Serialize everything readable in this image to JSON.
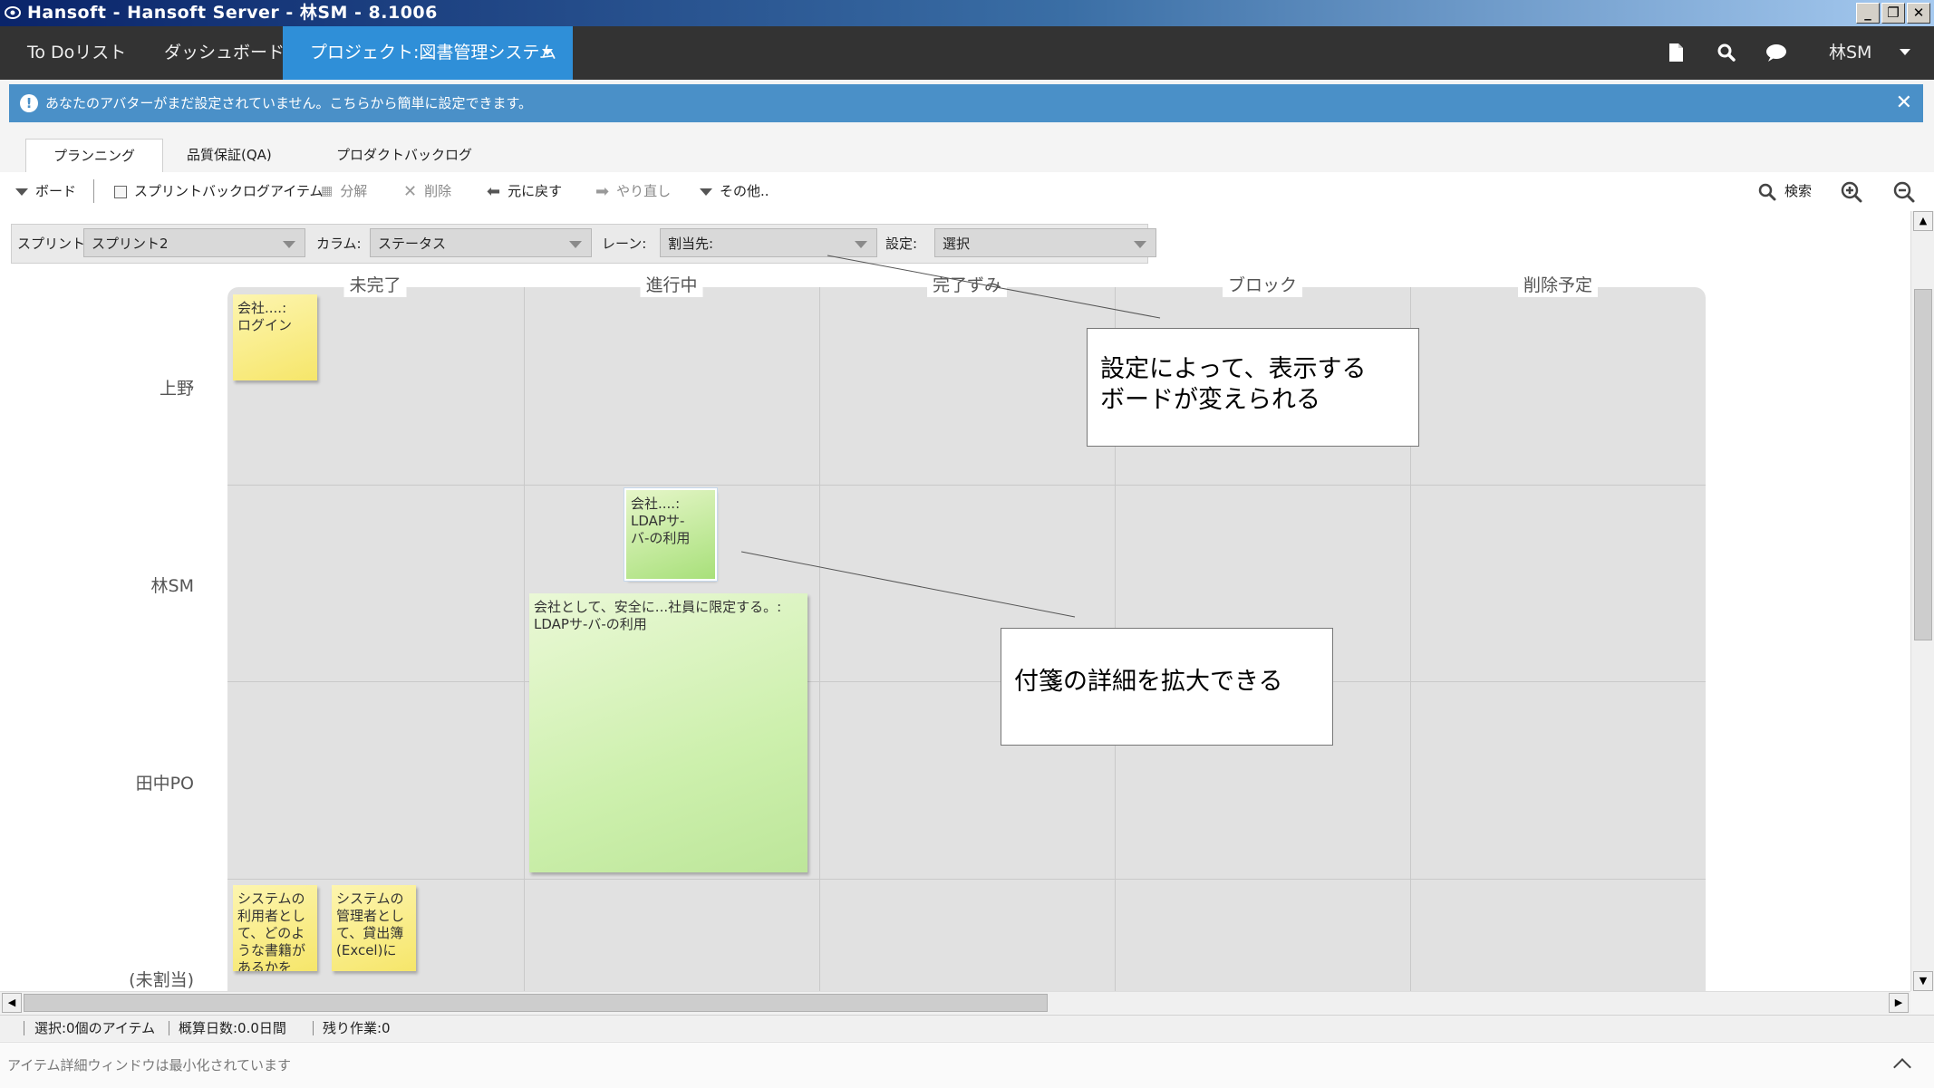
{
  "window": {
    "title": "Hansoft - Hansoft Server - 林SM - 8.1006",
    "min": "_",
    "restore": "❐",
    "close": "✕"
  },
  "nav": {
    "tabs": [
      {
        "label": "To Doリスト"
      },
      {
        "label": "ダッシュボード"
      },
      {
        "label": "プロジェクト:図書管理システム"
      }
    ],
    "user": "林SM",
    "icons": [
      "document-icon",
      "search-icon",
      "chat-icon"
    ]
  },
  "banner": {
    "message": "あなたのアバターがまだ設定されていません。こちらから簡単に設定できます。",
    "close": "✕",
    "info": "!"
  },
  "subtabs": [
    "プランニング",
    "品質保証(QA)",
    "プロダクトバックログ"
  ],
  "toolbar": {
    "board": "ボード",
    "sprint_item": "スプリントバックログアイテム",
    "split": "分解",
    "delete": "削除",
    "undo": "元に戻す",
    "redo": "やり直し",
    "more": "その他..",
    "search": "検索"
  },
  "filters": {
    "sprint_label": "スプリント:",
    "sprint_value": "スプリント2",
    "column_label": "カラム:",
    "column_value": "ステータス",
    "lane_label": "レーン:",
    "lane_value": "割当先:",
    "setting_label": "設定:",
    "setting_value": "選択"
  },
  "board": {
    "columns": [
      "未完了",
      "進行中",
      "完了ずみ",
      "ブロック",
      "削除予定"
    ],
    "lanes": [
      "上野",
      "林SM",
      "田中PO",
      "(未割当)"
    ],
    "notes": {
      "n1": "会社....:\nログイン",
      "n2": "会社....:\nLDAPサ-\nバ-の利用",
      "n3": "会社として、安全に...社員に限定する。:\nLDAPサ-バ-の利用",
      "n4": "システムの利用者として、どのような書籍があるかを",
      "n5": "システムの管理者として、貸出簿(Excel)に"
    }
  },
  "callouts": {
    "c1": "設定によって、表示する\nボードが変えられる",
    "c2": "付箋の詳細を拡大できる"
  },
  "status": {
    "selection": "選択:0個のアイテム",
    "estimate": "概算日数:0.0日間",
    "remaining": "残り作業:0"
  },
  "detail_window": "アイテム詳細ウィンドウは最小化されています"
}
